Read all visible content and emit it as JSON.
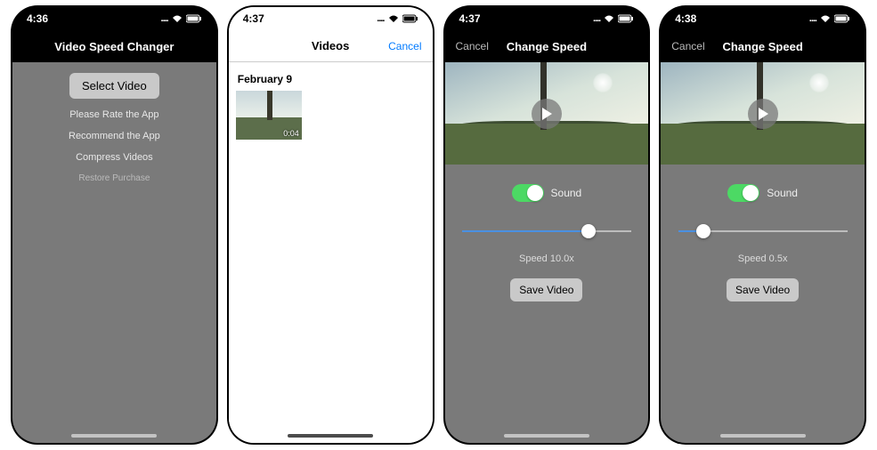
{
  "status": {
    "signal": "....",
    "wifi": "wifi",
    "battery": "bat"
  },
  "screen1": {
    "time": "4:36",
    "title": "Video Speed Changer",
    "select_button": "Select Video",
    "link_rate": "Please Rate the App",
    "link_recommend": "Recommend the App",
    "link_compress": "Compress Videos",
    "link_restore": "Restore Purchase"
  },
  "screen2": {
    "time": "4:37",
    "title": "Videos",
    "cancel": "Cancel",
    "section": "February 9",
    "duration": "0:04"
  },
  "screen3": {
    "time": "4:37",
    "title": "Change Speed",
    "cancel": "Cancel",
    "sound_label": "Sound",
    "sound_on": true,
    "slider_percent": 75,
    "speed_text": "Speed 10.0x",
    "save_button": "Save Video"
  },
  "screen4": {
    "time": "4:38",
    "title": "Change Speed",
    "cancel": "Cancel",
    "sound_label": "Sound",
    "sound_on": true,
    "slider_percent": 15,
    "speed_text": "Speed 0.5x",
    "save_button": "Save Video"
  }
}
